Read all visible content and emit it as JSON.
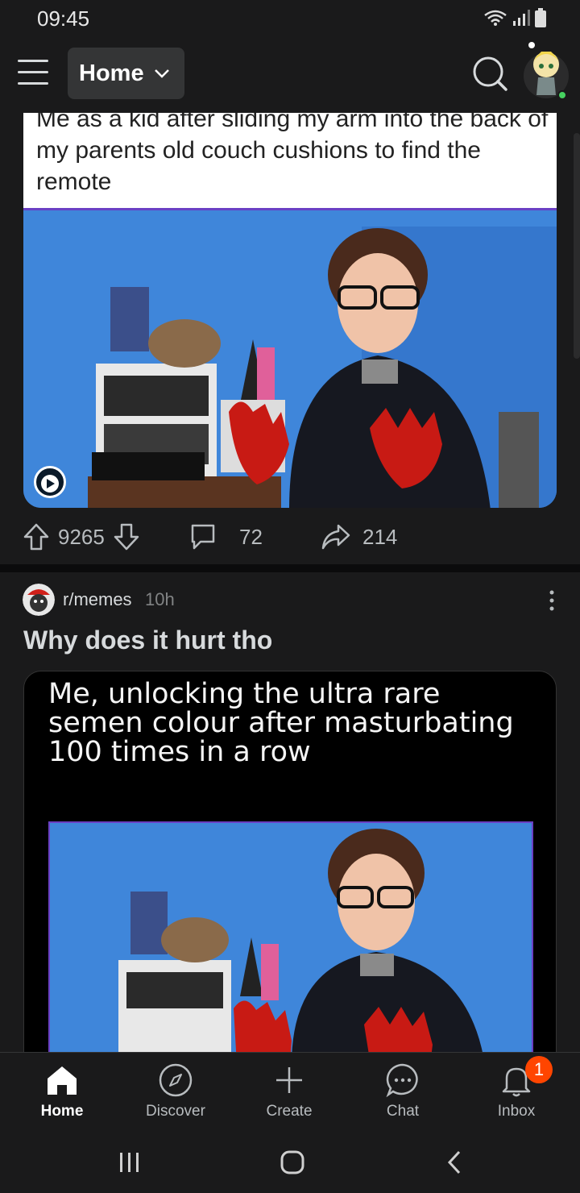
{
  "status_bar": {
    "time": "09:45",
    "icons": [
      "wifi-icon",
      "signal-icon",
      "battery-icon"
    ]
  },
  "header": {
    "feed_label": "Home",
    "search_icon": "search-icon",
    "avatar": "user-avatar"
  },
  "post1": {
    "caption": "Me as a kid after sliding my arm into the back of my parents old couch cushions to find the remote",
    "media_type": "video",
    "upvotes": "9265",
    "comments": "72",
    "shares": "214"
  },
  "post2": {
    "subreddit": "r/memes",
    "age": "10h",
    "title": "Why does it hurt tho",
    "image_caption": "Me, unlocking the ultra rare semen colour after masturbating 100 times in a row"
  },
  "bottom_nav": {
    "items": [
      {
        "label": "Home",
        "icon": "home-icon"
      },
      {
        "label": "Discover",
        "icon": "compass-icon"
      },
      {
        "label": "Create",
        "icon": "plus-icon"
      },
      {
        "label": "Chat",
        "icon": "chat-icon"
      },
      {
        "label": "Inbox",
        "icon": "bell-icon"
      }
    ],
    "inbox_badge": "1"
  },
  "colors": {
    "background": "#1a1a1b",
    "accent": "#ff4500",
    "online": "#46d160"
  }
}
